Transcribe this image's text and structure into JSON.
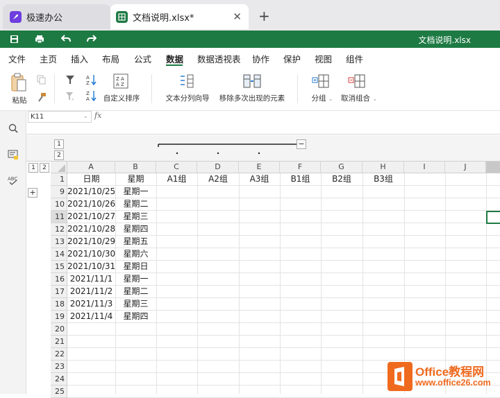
{
  "tabs": [
    {
      "label": "极速办公"
    },
    {
      "label": "文档说明.xlsx*"
    }
  ],
  "new_tab": "+",
  "doc_title": "文档说明.xlsx",
  "menu": [
    "文件",
    "主页",
    "插入",
    "布局",
    "公式",
    "数据",
    "数据透视表",
    "协作",
    "保护",
    "视图",
    "组件"
  ],
  "active_menu": "数据",
  "ribbon": {
    "paste": "粘贴",
    "custom_sort": "自定义排序",
    "text_to_columns": "文本分列向导",
    "remove_duplicates": "移除多次出现的元素",
    "group": "分组",
    "ungroup": "取消组合"
  },
  "name_box": "K11",
  "fx": "fx",
  "outline": {
    "row_levels": [
      "1",
      "2"
    ],
    "col_levels": [
      "1",
      "2"
    ],
    "collapse": "−",
    "expand": "+"
  },
  "columns": [
    "A",
    "B",
    "C",
    "D",
    "E",
    "F",
    "G",
    "H",
    "I",
    "J"
  ],
  "rows": [
    {
      "num": "1",
      "a": "日期",
      "b": "星期",
      "c": "A1组",
      "d": "A2组",
      "e": "A3组",
      "f": "B1组",
      "g": "B2组",
      "h": "B3组"
    },
    {
      "num": "9",
      "a": "2021/10/25",
      "b": "星期一"
    },
    {
      "num": "10",
      "a": "2021/10/26",
      "b": "星期二"
    },
    {
      "num": "11",
      "a": "2021/10/27",
      "b": "星期三"
    },
    {
      "num": "12",
      "a": "2021/10/28",
      "b": "星期四"
    },
    {
      "num": "13",
      "a": "2021/10/29",
      "b": "星期五"
    },
    {
      "num": "14",
      "a": "2021/10/30",
      "b": "星期六"
    },
    {
      "num": "15",
      "a": "2021/10/31",
      "b": "星期日"
    },
    {
      "num": "16",
      "a": "2021/11/1",
      "b": "星期一"
    },
    {
      "num": "17",
      "a": "2021/11/2",
      "b": "星期二"
    },
    {
      "num": "18",
      "a": "2021/11/3",
      "b": "星期三"
    },
    {
      "num": "19",
      "a": "2021/11/4",
      "b": "星期四"
    },
    {
      "num": "20"
    },
    {
      "num": "21"
    },
    {
      "num": "22"
    },
    {
      "num": "23"
    },
    {
      "num": "24"
    },
    {
      "num": "25"
    }
  ],
  "selected_cell": "K11",
  "watermark": {
    "line1": "Office教程网",
    "line2": "www.office26.com"
  },
  "colors": {
    "accent": "#1d7a43",
    "watermark": "#f06a1e"
  }
}
